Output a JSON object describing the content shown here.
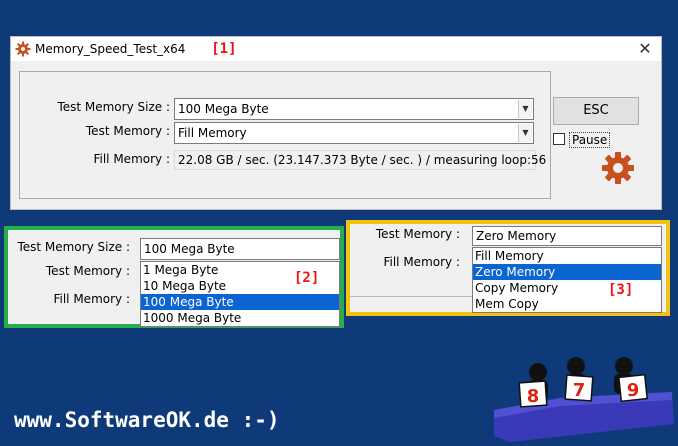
{
  "window": {
    "title": "Memory_Speed_Test_x64",
    "badge": "[1]",
    "close_glyph": "✕",
    "labels": {
      "size": "Test Memory Size :",
      "mode": "Test Memory :",
      "fill": "Fill Memory :"
    },
    "size_value": "100 Mega Byte",
    "mode_value": "Fill Memory",
    "fill_readout": "22.08 GB / sec. (23.147.373 Byte / sec. ) / measuring loop:56",
    "esc_label": "ESC",
    "pause_label": "Pause",
    "pause_checked": false,
    "gear_icon": "gear-icon"
  },
  "panel_size": {
    "badge": "[2]",
    "labels": {
      "size": "Test Memory Size :",
      "mode": "Test Memory :",
      "fill": "Fill Memory :"
    },
    "selected": "100 Mega Byte",
    "options": [
      "1 Mega Byte",
      "10 Mega Byte",
      "100 Mega Byte",
      "1000 Mega Byte"
    ],
    "highlighted_index": 2,
    "border_color": "#27ae4a"
  },
  "panel_mode": {
    "badge": "[3]",
    "labels": {
      "mode": "Test Memory :",
      "fill": "Fill Memory :"
    },
    "selected": "Zero Memory",
    "options": [
      "Fill Memory",
      "Zero Memory",
      "Copy Memory",
      "Mem Copy"
    ],
    "highlighted_index": 1,
    "border_color": "#f2c20f"
  },
  "footer": {
    "site": "www.SoftwareOK.de :-)",
    "judges": [
      "8",
      "7",
      "9"
    ]
  },
  "colors": {
    "background": "#0f3a7a",
    "selection": "#0a64d2",
    "badge": "#e11111",
    "judge_bench": "#3a3ab8"
  }
}
